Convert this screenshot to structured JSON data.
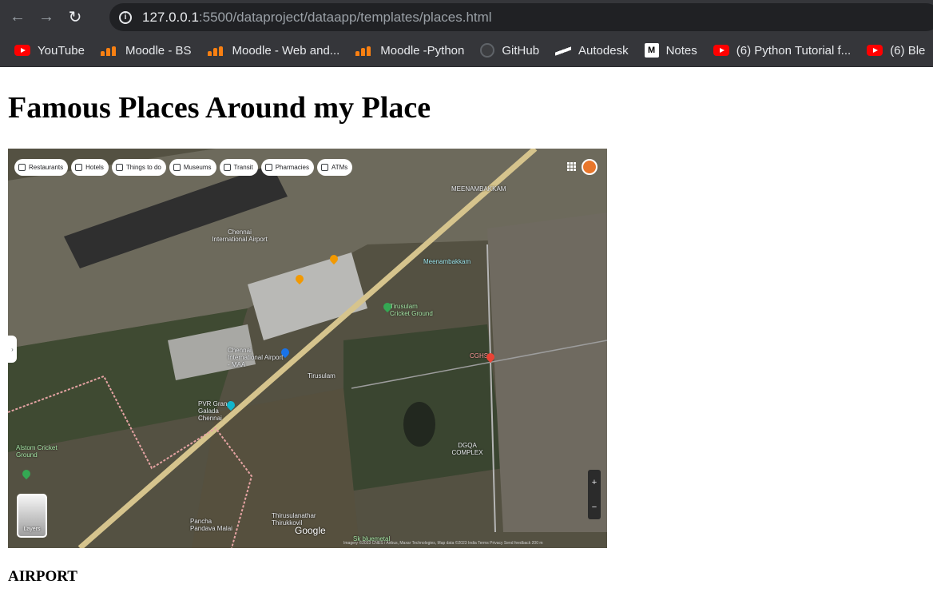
{
  "browser": {
    "url_host": "127.0.0.1",
    "url_rest": ":5500/dataproject/dataapp/templates/places.html",
    "nav": {
      "back_icon": "back-arrow-icon",
      "forward_icon": "forward-arrow-icon",
      "reload_icon": "reload-icon"
    },
    "bookmarks": [
      {
        "label": "YouTube",
        "icon": "youtube-icon"
      },
      {
        "label": "Moodle - BS",
        "icon": "moodle-icon"
      },
      {
        "label": "Moodle - Web and...",
        "icon": "moodle-icon"
      },
      {
        "label": "Moodle -Python",
        "icon": "moodle-icon"
      },
      {
        "label": "GitHub",
        "icon": "github-icon"
      },
      {
        "label": "Autodesk",
        "icon": "autodesk-icon"
      },
      {
        "label": "Notes",
        "icon": "notes-icon"
      },
      {
        "label": "(6) Python Tutorial f...",
        "icon": "youtube-icon"
      },
      {
        "label": "(6) Ble",
        "icon": "youtube-icon"
      }
    ]
  },
  "page": {
    "title": "Famous Places Around my Place",
    "caption": "AIRPORT"
  },
  "map": {
    "chips": [
      "Restaurants",
      "Hotels",
      "Things to do",
      "Museums",
      "Transit",
      "Pharmacies",
      "ATMs"
    ],
    "labels": {
      "meenambakkam_top": "MEENAMBAKKAM",
      "airport_top": "Chennai International Airport",
      "meenambakkam_station": "Meenambakkam",
      "tirusulam_ground": "Tirusulam Cricket Ground",
      "cghs": "CGHS",
      "airport_maa": "Chennai International Airport - MAA",
      "tirusulam": "Tirusulam",
      "pvr": "PVR Grand Galada Chennai",
      "dgqa": "DGQA COMPLEX",
      "alstom": "Alstom Cricket Ground",
      "thirusulanathar": "Thirusulanathar Thirukkovil",
      "pancha": "Pancha Pandava Malai",
      "sk": "Sk bluemetal",
      "layers": "Layers",
      "google": "Google",
      "attribution": "Imagery ©2023 CNES / Airbus, Maxar Technologies, Map data ©2023   India   Terms   Privacy   Send feedback   200 m"
    }
  }
}
